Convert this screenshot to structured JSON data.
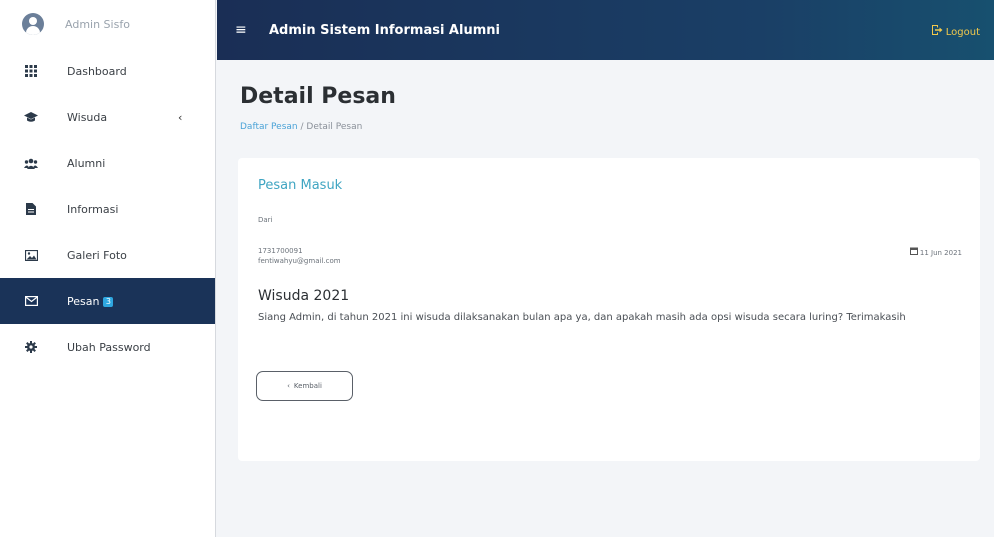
{
  "brand": {
    "name": "Admin Sisfo"
  },
  "sidebar": {
    "items": [
      {
        "label": "Dashboard",
        "icon": "grid-icon"
      },
      {
        "label": "Wisuda",
        "icon": "graduation-cap-icon",
        "chevron": "‹"
      },
      {
        "label": "Alumni",
        "icon": "users-icon"
      },
      {
        "label": "Informasi",
        "icon": "file-icon"
      },
      {
        "label": "Galeri Foto",
        "icon": "image-icon"
      },
      {
        "label": "Pesan",
        "icon": "envelope-icon",
        "badge": "3",
        "active": true
      },
      {
        "label": "Ubah Password",
        "icon": "gear-icon"
      }
    ]
  },
  "topbar": {
    "menu_glyph": "≡",
    "title": "Admin Sistem Informasi Alumni",
    "logout_label": "Logout"
  },
  "page": {
    "title": "Detail Pesan",
    "breadcrumb": {
      "link": "Daftar Pesan",
      "separator": " / ",
      "current": "Detail Pesan"
    }
  },
  "card": {
    "title": "Pesan Masuk",
    "from_label": "Dari",
    "sender_id": "1731700091",
    "sender_email": "fentiwahyu@gmail.com",
    "date": "11 Jun 2021",
    "subject": "Wisuda 2021",
    "message": "Siang Admin, di tahun 2021 ini wisuda dilaksanakan bulan apa ya, dan apakah masih ada opsi wisuda secara luring? Terimakasih",
    "back_label": "Kembali"
  },
  "colors": {
    "sidebar_active": "#1a3358",
    "topbar": "#1a2e55",
    "accent": "#3fa5c2",
    "logout": "#f2c94c",
    "badge": "#2ea7e0"
  }
}
